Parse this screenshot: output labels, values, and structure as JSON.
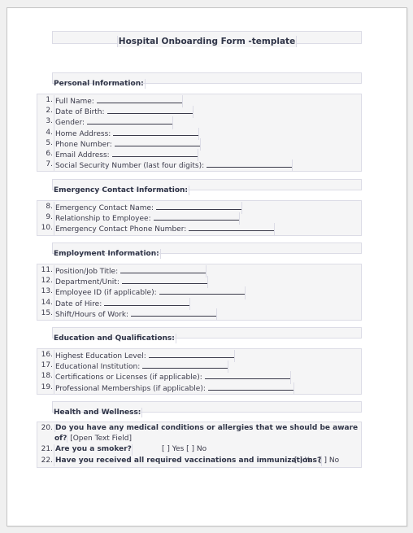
{
  "document": {
    "title": "Hospital Onboarding Form -template"
  },
  "sections": [
    {
      "heading": "Personal Information:",
      "items": [
        {
          "num": "1.",
          "label": "Full Name:"
        },
        {
          "num": "2.",
          "label": "Date of Birth:"
        },
        {
          "num": "3.",
          "label": "Gender:"
        },
        {
          "num": "4.",
          "label": "Home Address:"
        },
        {
          "num": "5.",
          "label": "Phone Number:"
        },
        {
          "num": "6.",
          "label": "Email Address:"
        },
        {
          "num": "7.",
          "label": "Social Security Number (last four digits):"
        }
      ]
    },
    {
      "heading": "Emergency Contact Information:",
      "items": [
        {
          "num": "8.",
          "label": "Emergency Contact Name:"
        },
        {
          "num": "9.",
          "label": "Relationship to Employee:"
        },
        {
          "num": "10.",
          "label": "Emergency Contact Phone Number:"
        }
      ]
    },
    {
      "heading": "Employment Information:",
      "items": [
        {
          "num": "11.",
          "label": "Position/Job Title:"
        },
        {
          "num": "12.",
          "label": "Department/Unit:"
        },
        {
          "num": "13.",
          "label": "Employee ID (if applicable):"
        },
        {
          "num": "14.",
          "label": "Date of Hire:"
        },
        {
          "num": "15.",
          "label": "Shift/Hours of Work:"
        }
      ]
    },
    {
      "heading": "Education and Qualifications:",
      "items": [
        {
          "num": "16.",
          "label": "Highest Education Level:"
        },
        {
          "num": "17.",
          "label": "Educational Institution:"
        },
        {
          "num": "18.",
          "label": "Certifications or Licenses (if applicable):"
        },
        {
          "num": "19.",
          "label": "Professional Memberships (if applicable):"
        }
      ]
    },
    {
      "heading": "Health and Wellness:",
      "items": [
        {
          "num": "20.",
          "question": "Do you have any medical conditions or allergies that we should be aware of?",
          "answer": "[Open Text Field]"
        },
        {
          "num": "21.",
          "question": "Are you a smoker?",
          "answer": "[ ] Yes [ ] No"
        },
        {
          "num": "22.",
          "question": "Have you received all required vaccinations and immunizations?",
          "answer": "[ ] Yes [ ] No"
        }
      ]
    }
  ]
}
